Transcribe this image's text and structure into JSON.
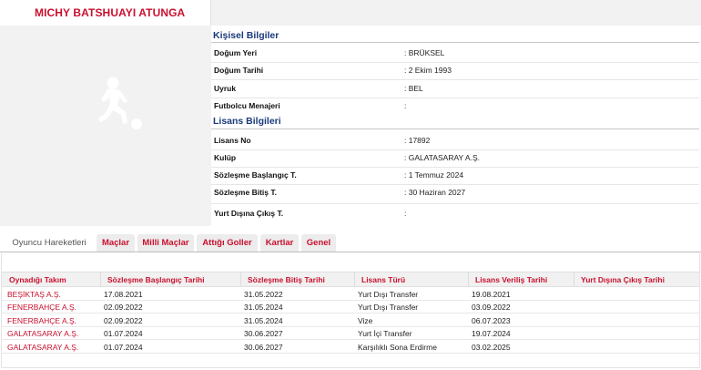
{
  "player": {
    "name": "MICHY BATSHUAYI ATUNGA"
  },
  "personal": {
    "title": "Kişisel Bilgiler",
    "rows": [
      {
        "label": "Doğum Yeri",
        "value": ":  BRÜKSEL"
      },
      {
        "label": "Doğum Tarihi",
        "value": ":  2 Ekim 1993"
      },
      {
        "label": "Uyruk",
        "value": ":  BEL"
      },
      {
        "label": "Futbolcu Menajeri",
        "value": ":"
      }
    ]
  },
  "license": {
    "title": "Lisans Bilgileri",
    "rows": [
      {
        "label": "Lisans No",
        "value": ": 17892"
      },
      {
        "label": "Kulüp",
        "value": ": GALATASARAY A.Ş."
      },
      {
        "label": "Sözleşme Başlangıç T.",
        "value": ": 1 Temmuz 2024"
      },
      {
        "label": "Sözleşme Bitiş T.",
        "value": ": 30 Haziran 2027"
      },
      {
        "label": "Yurt Dışına Çıkış T.",
        "value": ":"
      }
    ]
  },
  "tabs": [
    {
      "label": "Oyuncu Hareketleri",
      "active": true
    },
    {
      "label": "Maçlar",
      "active": false
    },
    {
      "label": "Milli Maçlar",
      "active": false
    },
    {
      "label": "Attığı Goller",
      "active": false
    },
    {
      "label": "Kartlar",
      "active": false
    },
    {
      "label": "Genel",
      "active": false
    }
  ],
  "table": {
    "headers": [
      "Oynadığı Takım",
      "Sözleşme Başlangıç Tarihi",
      "Sözleşme Bitiş Tarihi",
      "Lisans Türü",
      "Lisans Veriliş Tarihi",
      "Yurt Dışına Çıkış Tarihi"
    ],
    "rows": [
      [
        "BEŞİKTAŞ A.Ş.",
        "17.08.2021",
        "31.05.2022",
        "Yurt Dışı Transfer",
        "19.08.2021",
        ""
      ],
      [
        "FENERBAHÇE A.Ş.",
        "02.09.2022",
        "31.05.2024",
        "Yurt Dışı Transfer",
        "03.09.2022",
        ""
      ],
      [
        "FENERBAHÇE A.Ş.",
        "02.09.2022",
        "31.05.2024",
        "Vize",
        "06.07.2023",
        ""
      ],
      [
        "GALATASARAY A.Ş.",
        "01.07.2024",
        "30.06.2027",
        "Yurt İçi Transfer",
        "19.07.2024",
        ""
      ],
      [
        "GALATASARAY A.Ş.",
        "01.07.2024",
        "30.06.2027",
        "Karşılıklı Sona Erdirme",
        "03.02.2025",
        ""
      ]
    ]
  },
  "colors": {
    "accent_red": "#c8102e",
    "section_blue": "#1a3a7c"
  },
  "icons": {
    "player_photo": "football-player-silhouette-icon"
  }
}
